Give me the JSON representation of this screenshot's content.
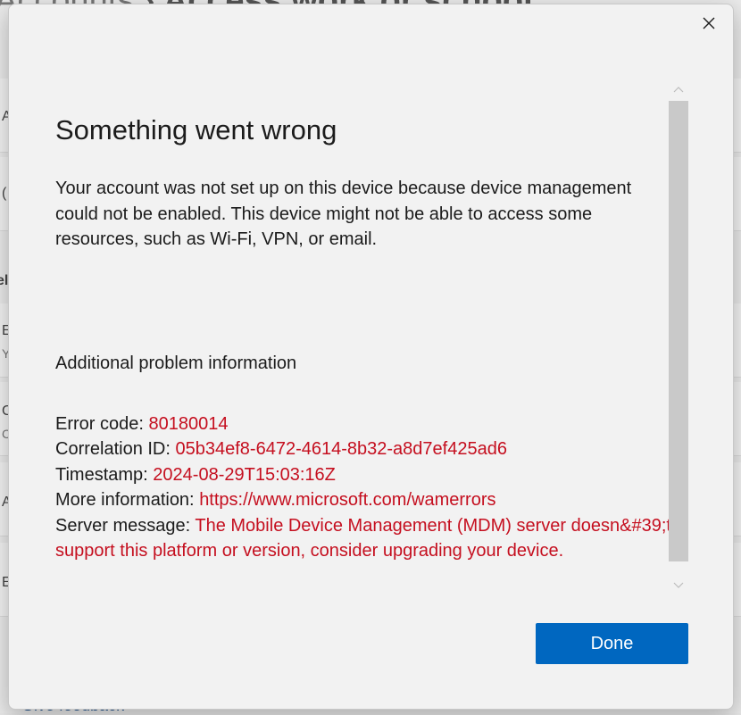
{
  "background": {
    "title_crumb": "Accounts",
    "title_page": "Access work or school",
    "row_letters": [
      "A",
      "(",
      "el",
      "E",
      "Y",
      "C",
      "C",
      "A",
      "E"
    ],
    "feedback_link": "Give feedback"
  },
  "dialog": {
    "heading": "Something went wrong",
    "message": "Your account was not set up on this device because device management could not be enabled. This device might not be able to access some resources, such as Wi-Fi, VPN, or email.",
    "additional_heading": "Additional problem information",
    "info": {
      "error_code_label": "Error code:",
      "error_code_value": "80180014",
      "correlation_label": "Correlation ID:",
      "correlation_value": "05b34ef8-6472-4614-8b32-a8d7ef425ad6",
      "timestamp_label": "Timestamp:",
      "timestamp_value": "2024-08-29T15:03:16Z",
      "more_info_label": "More information:",
      "more_info_value": "https://www.microsoft.com/wamerrors",
      "server_message_label": "Server message:",
      "server_message_value": "The Mobile Device Management (MDM) server doesn&#39;t support this platform or version, consider upgrading your device."
    },
    "done_label": "Done",
    "close_icon": "close-icon"
  },
  "colors": {
    "accent": "#0067c0",
    "error_text": "#c50f1f"
  }
}
